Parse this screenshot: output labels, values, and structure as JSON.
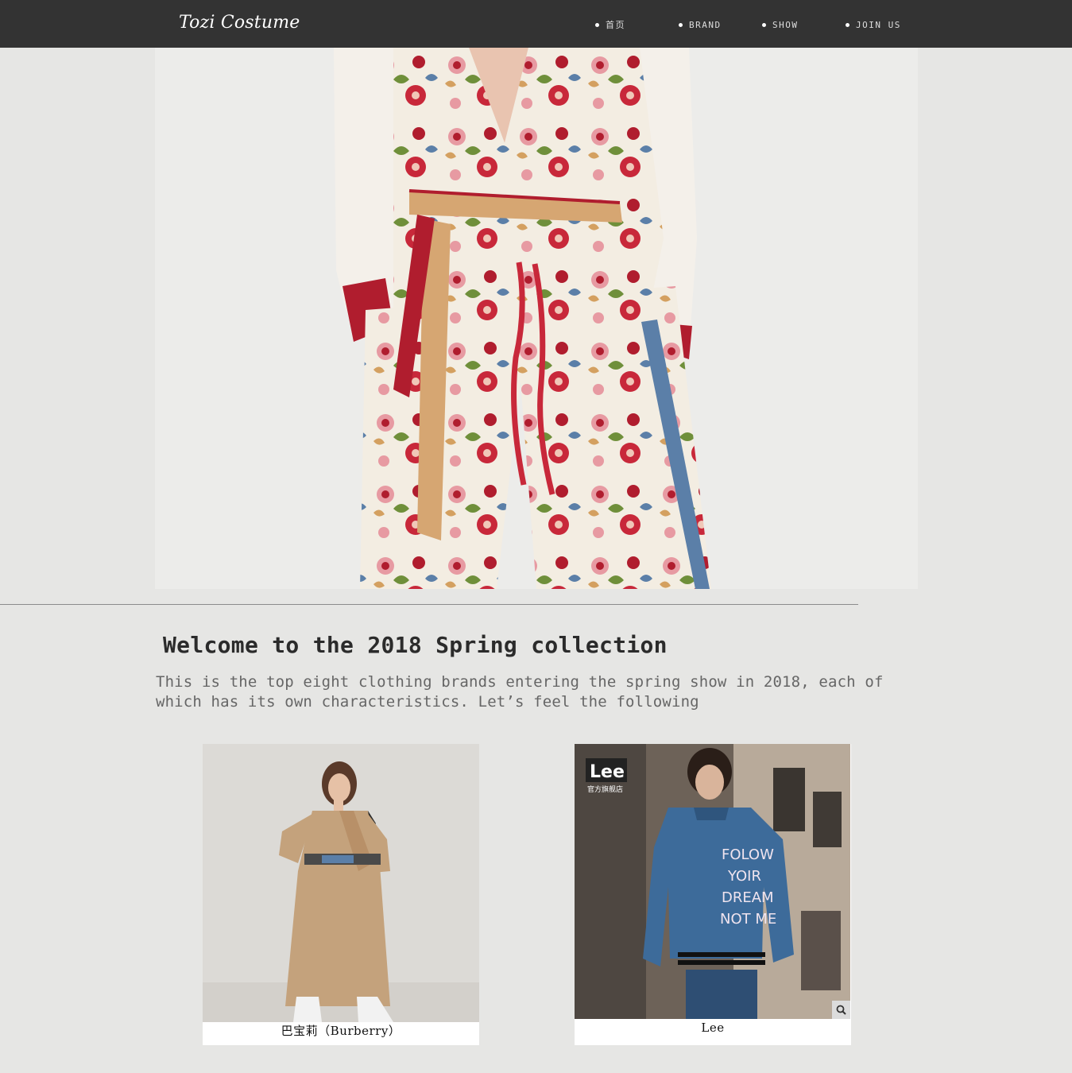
{
  "header": {
    "brand": "Tozi Costume",
    "nav": [
      {
        "label": "首页"
      },
      {
        "label": "BRAND"
      },
      {
        "label": "SHOW"
      },
      {
        "label": "JOIN US"
      }
    ]
  },
  "intro": {
    "heading": "Welcome to the 2018 Spring collection",
    "text": "This is the top eight clothing brands entering the spring show in 2018, each of which has its own characteristics. Let’s feel the following"
  },
  "brands": [
    {
      "caption": "巴宝莉（Burberry）"
    },
    {
      "caption": "Lee",
      "logo_text": "Lee",
      "shop_text": "官方旗舰店",
      "jacket_text": [
        "FOLOW",
        "YOIR",
        "DREAM",
        "NOT ME"
      ]
    }
  ],
  "colors": {
    "topbar": "#333333",
    "page_bg": "#e6e6e4",
    "floral_red": "#b01d2e",
    "floral_pink": "#e79aa2",
    "denim": "#3d6b9a",
    "trench": "#c4a27c"
  },
  "icons": {
    "zoom": "magnifier-icon"
  }
}
